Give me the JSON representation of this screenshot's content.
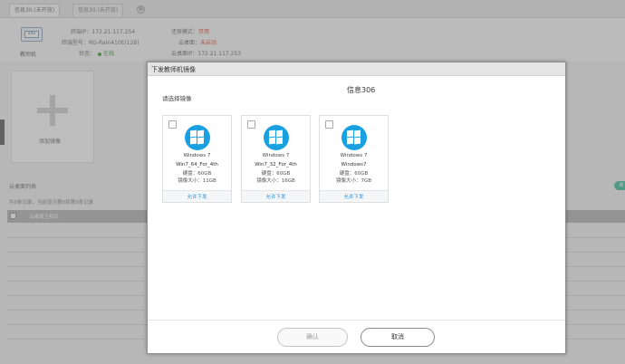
{
  "tabs": [
    {
      "label": "信息30.(未开放)"
    },
    {
      "label": "信息30.(未开放)"
    }
  ],
  "tab_add_glyph": "⊕",
  "terminal": {
    "icon_text": "alto",
    "label": "教师机",
    "ip_label": "终端IP：",
    "ip": "172.21.117.254",
    "model_label": "终端型号：",
    "model": "RG-Rain410E(128)",
    "status_label": "状态：",
    "status": "在线",
    "restore_label": "还原模式：",
    "restore": "禁用",
    "cloud_label": "云桌面：",
    "cloud": "未启动",
    "cloud_ip_label": "云桌面IP：",
    "cloud_ip": "172.21.117.253"
  },
  "add_image_label": "添加镜像",
  "section_label": "云桌面列表",
  "hint_text": "共0条记录，当前显示第0到第0条记录",
  "table_band_text": "云桌面主机名",
  "green_pill_text": "刷",
  "dialog": {
    "title": "下发教师机镜像",
    "prompt": "请选择镜像",
    "location": "信息306",
    "images": [
      {
        "os": "Windows 7",
        "name": "Win7_64_For_4th",
        "disk": "硬盘：60GB",
        "size": "镜像大小：11GB",
        "action": "允许下发"
      },
      {
        "os": "Windows 7",
        "name": "Win7_32_For_4th",
        "disk": "硬盘：60GB",
        "size": "镜像大小：16GB",
        "action": "允许下发"
      },
      {
        "os": "Windows 7",
        "name": "Windows7",
        "disk": "硬盘：60GB",
        "size": "镜像大小：7GB",
        "action": "允许下发"
      }
    ],
    "confirm_label": "确认",
    "cancel_label": "取消"
  },
  "colors": {
    "windows_blue": "#19a0e0",
    "link_blue": "#2e8fd6",
    "disabled_red": "#e25b4b",
    "online_green": "#4aa84a"
  },
  "icons": {
    "windows_logo": "windows-logo-icon",
    "checkbox": "checkbox-icon",
    "add": "plus-icon"
  }
}
